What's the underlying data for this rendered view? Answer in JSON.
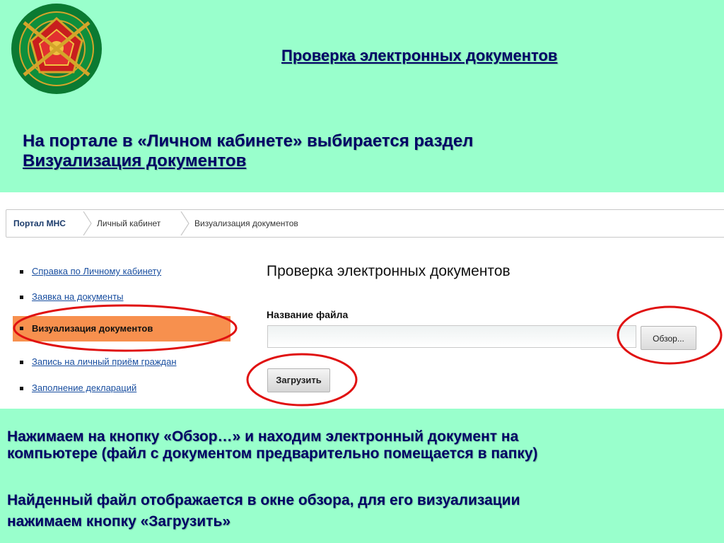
{
  "slide": {
    "title": "Проверка электронных документов",
    "intro_line1": "На портале в «Личном кабинете» выбирается раздел",
    "intro_link": "Визуализация документов",
    "note1_line1": "Нажимаем на кнопку «Обзор…» и находим электронный документ на",
    "note1_line2": "компьютере (файл с документом предварительно помещается в папку)",
    "note2_line1": "Найденный файл отображается в окне обзора, для его визуализации",
    "note2_line2": "нажимаем кнопку «Загрузить»"
  },
  "portal": {
    "breadcrumb": [
      "Портал МНС",
      "Личный кабинет",
      "Визуализация документов"
    ],
    "sidebar": [
      {
        "label": "Справка по Личному кабинету"
      },
      {
        "label": "Заявка на документы"
      },
      {
        "label": "Визуализация документов",
        "active": true
      },
      {
        "label": "Запись на личный приём граждан"
      },
      {
        "label": "Заполнение деклараций"
      }
    ],
    "form": {
      "title": "Проверка электронных документов",
      "file_label": "Название файла",
      "file_value": "",
      "browse_label": "Обзор...",
      "upload_label": "Загрузить"
    }
  },
  "colors": {
    "slide_background": "#99ffcc",
    "slide_text": "#000066",
    "active_item": "#f7904e",
    "highlight_ellipse": "#e01010",
    "link": "#1a4fa0"
  },
  "icons": {
    "emblem": "ministry-emblem-icon",
    "breadcrumb_separator": "chevron-right-icon",
    "list_bullet": "square-bullet-icon"
  }
}
